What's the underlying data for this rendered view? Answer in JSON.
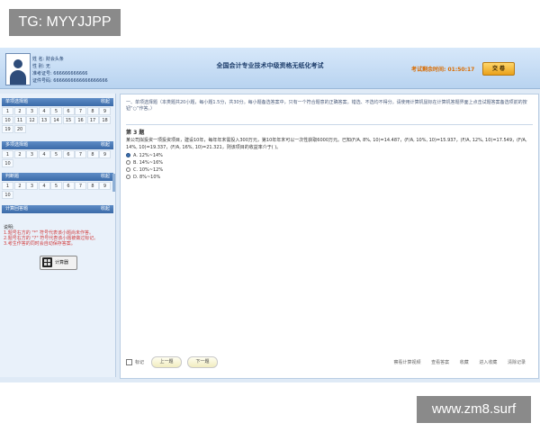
{
  "watermarks": {
    "top_left": "TG: MYYJJPP",
    "bottom_right": "www.zm8.surf"
  },
  "header": {
    "info_lines": [
      "姓 名: 财会头条",
      "性 别: 无",
      "准考证号: 666666666666",
      "证件号码: 6666666666666666666"
    ],
    "title": "全国会计专业技术中级资格无纸化考试",
    "timer_label": "考试剩余时间:",
    "timer_value": "01:50:17",
    "submit_label": "交 卷"
  },
  "sidebar": {
    "sections": [
      {
        "name": "单项选择题",
        "control": "收起",
        "items": [
          "1",
          "2",
          "3",
          "4",
          "5",
          "6",
          "7",
          "8",
          "9",
          "10",
          "11",
          "12",
          "13",
          "14",
          "15",
          "16",
          "17",
          "18",
          "19",
          "20"
        ]
      },
      {
        "name": "多项选择题",
        "control": "收起",
        "items": [
          "1",
          "2",
          "3",
          "4",
          "5",
          "6",
          "7",
          "8",
          "9",
          "10"
        ]
      },
      {
        "name": "判断题",
        "control": "收起",
        "items": [
          "1",
          "2",
          "3",
          "4",
          "5",
          "6",
          "7",
          "8",
          "9",
          "10"
        ]
      },
      {
        "name": "计算回答题",
        "control": "收起",
        "items": []
      }
    ],
    "notes": {
      "title": "说明:",
      "lines": [
        "1.题号右方的 \"*\" 符号代表该小题尚未作答。",
        "2.题号右方的 \"?\" 符号代表该小题被做过标记。",
        "3.考生作答的同时会自动保存答案。"
      ]
    },
    "calculator_label": "计算器"
  },
  "main": {
    "instructions": "一、单项选择题（本类题共20小题，每小题1.5分，共30分。每小题备选答案中，只有一个符合题意的正确答案。错选、不选均不得分。请使用计算机鼠标在计算机答题界面上点击试题答案备选项前的按钮“○”作答。）",
    "question_no": "第 3 题",
    "question_text": "某公司拟投资一项投资项目，建设10年，每年年末需投入300万元，第10年年末可以一次性获取6000万元。已知(F/A, 8%, 10)=14.487，(F/A, 10%, 10)=15.937，(F/A, 12%, 10)=17.549，(F/A, 14%, 10)=19.337，(F/A, 16%, 10)=21.321，则该项目的收益率介于( )。",
    "options": [
      "A. 12%~14%",
      "B. 14%~16%",
      "C. 10%~12%",
      "D. 8%~10%"
    ],
    "selected_index": 0,
    "mark_label": "标记",
    "prev_label": "上一题",
    "next_label": "下一题",
    "links": [
      "察看计算视频",
      "查看答案",
      "收藏",
      "进入收藏",
      "清除记录"
    ]
  }
}
